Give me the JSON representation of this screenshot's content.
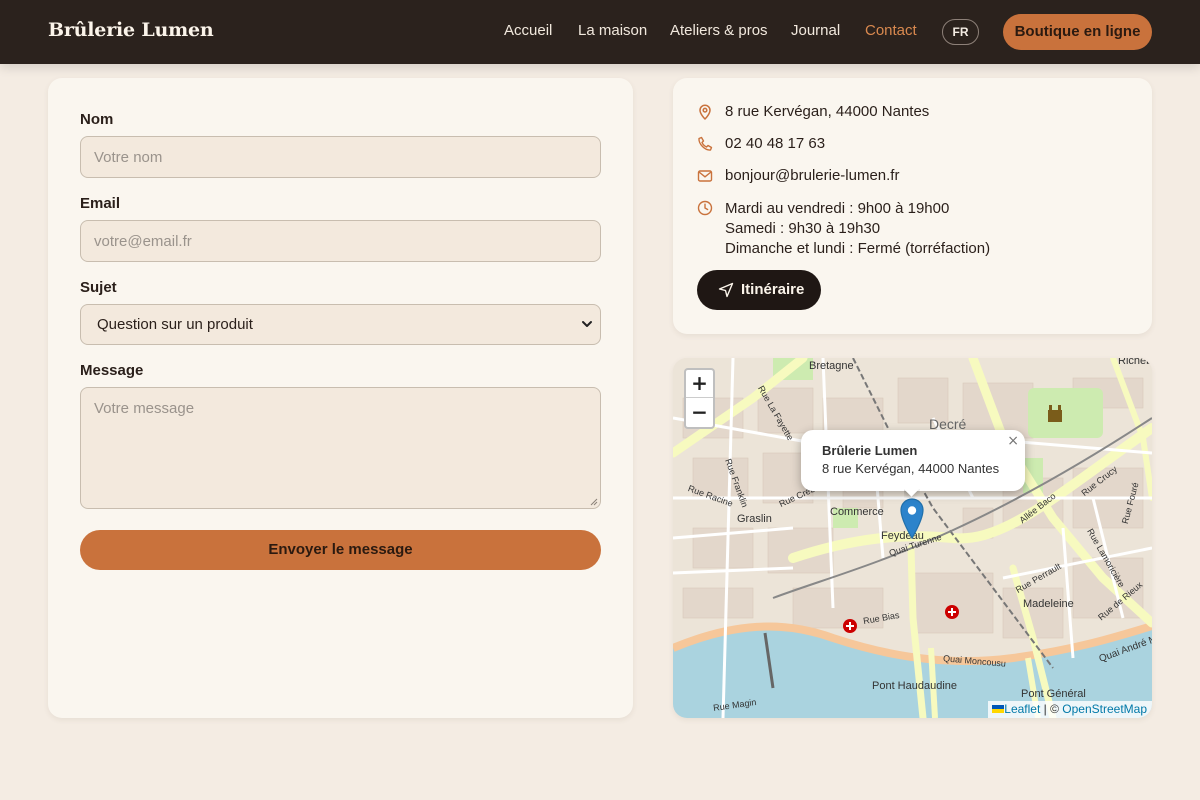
{
  "header": {
    "brand": "Brûlerie Lumen",
    "nav": [
      "Accueil",
      "La maison",
      "Ateliers & pros",
      "Journal",
      "Contact"
    ],
    "active_nav": "Contact",
    "lang": "FR",
    "shop_label": "Boutique en ligne"
  },
  "form": {
    "name_label": "Nom",
    "name_placeholder": "Votre nom",
    "email_label": "Email",
    "email_placeholder": "votre@email.fr",
    "subject_label": "Sujet",
    "subject_value": "Question sur un produit",
    "message_label": "Message",
    "message_placeholder": "Votre message",
    "submit_label": "Envoyer le message"
  },
  "contact": {
    "address": "8 rue Kervégan, 44000 Nantes",
    "phone": "02 40 48 17 63",
    "email": "bonjour@brulerie-lumen.fr",
    "hours": [
      "Mardi au vendredi : 9h00 à 19h00",
      "Samedi : 9h30 à 19h30",
      "Dimanche et lundi : Fermé (torréfaction)"
    ],
    "route_label": "Itinéraire"
  },
  "map": {
    "popup_title": "Brûlerie Lumen",
    "popup_address": "8 rue Kervégan, 44000 Nantes",
    "zoom_in": "+",
    "zoom_out": "−",
    "close": "×",
    "attribution_leaflet": "Leaflet",
    "attribution_sep": "| ©",
    "attribution_osm": "OpenStreetMap",
    "labels": [
      "Bretagne",
      "Decré",
      "Graslin",
      "Commerce",
      "Feydeau",
      "Quai Turenne",
      "Madeleine",
      "Pont Haudaudine",
      "Pont Général",
      "Quai André Morice",
      "Quai Moncousu",
      "Rue Bias",
      "Rue Racine",
      "Rue Franklin",
      "Rue Crébillon",
      "Rue La Fayette",
      "Allée Baco",
      "Rue Crucy",
      "Rue Perrault",
      "Rue Lamoricière",
      "Rue de Rieux",
      "Richebourg",
      "Rue Fouré",
      "Rue Magin"
    ]
  },
  "colors": {
    "header_bg": "#2b221d",
    "accent": "#c9723c",
    "page_bg": "#f4ece3",
    "card_bg": "#faf6ef",
    "field_bg": "#f3e9dd"
  }
}
